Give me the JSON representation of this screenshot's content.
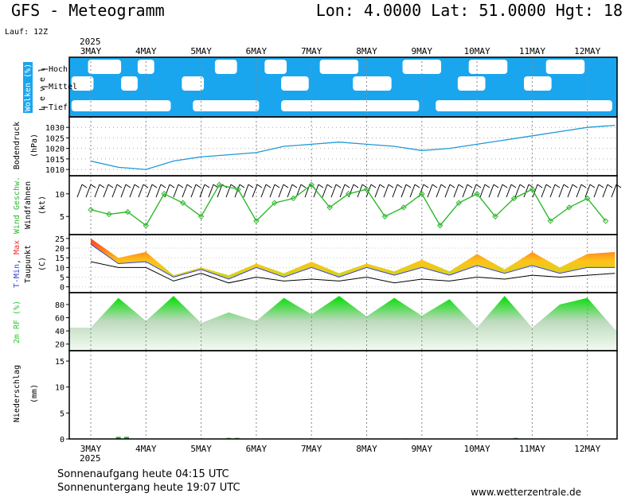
{
  "header": {
    "title": "GFS - Meteogramm",
    "location": "Lon: 4.0000  Lat: 51.0000  Hgt: 18",
    "run": "Lauf: 12Z",
    "year": "2025"
  },
  "footer": {
    "sunrise": "Sonnenaufgang heute 04:15 UTC",
    "sunset": "Sonnenuntergang heute 19:07 UTC",
    "site": "www.wetterzentrale.de"
  },
  "colors": {
    "cloud_sky": "#1aa6ee",
    "pressure": "#1f9ad6",
    "wind": "#2db82d",
    "tmin": "#3344dd",
    "tmax": "#ee3333",
    "dew": "#000000",
    "rh": "#2ec82e",
    "precip": "#2aa82a"
  },
  "chart_data": [
    {
      "type": "heatmap",
      "panel": "clouds",
      "ylabel": "Wolken (%)",
      "ylabel2": "L e v e l",
      "levels": [
        "Hoch",
        "Mittel",
        "Tief"
      ],
      "categories": [
        "3MAY",
        "4MAY",
        "5MAY",
        "6MAY",
        "7MAY",
        "8MAY",
        "9MAY",
        "10MAY",
        "11MAY",
        "12MAY"
      ]
    },
    {
      "type": "line",
      "panel": "pressure",
      "ylabel": "Bodendruck",
      "unit": "(hPa)",
      "ylim": [
        1007,
        1035
      ],
      "yticks": [
        1010,
        1015,
        1020,
        1025,
        1030
      ],
      "x_days": [
        0.0,
        0.5,
        1.0,
        1.5,
        2.0,
        2.5,
        3.0,
        3.5,
        4.0,
        4.5,
        5.0,
        5.5,
        6.0,
        6.5,
        7.0,
        7.5,
        8.0,
        8.5,
        9.0,
        9.5
      ],
      "series": [
        {
          "values": [
            1014,
            1011,
            1010,
            1014,
            1016,
            1017,
            1018,
            1021,
            1022,
            1023,
            1022,
            1021,
            1019,
            1020,
            1022,
            1024,
            1026,
            1028,
            1030,
            1031
          ]
        }
      ]
    },
    {
      "type": "line",
      "panel": "wind",
      "ylabel": "Wind Geschw.",
      "ylabel2": "Windfahnen",
      "unit": "(kt)",
      "ylim": [
        1,
        14
      ],
      "yticks": [
        5,
        10
      ],
      "x_days": [
        0.0,
        0.33,
        0.67,
        1.0,
        1.33,
        1.67,
        2.0,
        2.33,
        2.67,
        3.0,
        3.33,
        3.67,
        4.0,
        4.33,
        4.67,
        5.0,
        5.33,
        5.67,
        6.0,
        6.33,
        6.67,
        7.0,
        7.33,
        7.67,
        8.0,
        8.33,
        8.67,
        9.0,
        9.33
      ],
      "series": [
        {
          "values": [
            6.5,
            5.5,
            6,
            3,
            10,
            8,
            5,
            12,
            11,
            4,
            8,
            9,
            12,
            7,
            10,
            11,
            5,
            7,
            10,
            3,
            8,
            10,
            5,
            9,
            11,
            4,
            7,
            9,
            4
          ]
        }
      ]
    },
    {
      "type": "area",
      "panel": "temperature",
      "ylabel": "T-Min, Max",
      "ylabel2": "Taupunkt",
      "unit": "(C)",
      "ylim": [
        -3,
        27
      ],
      "yticks": [
        0,
        5,
        10,
        15,
        20,
        25
      ],
      "x_days": [
        0.0,
        0.5,
        1.0,
        1.5,
        2.0,
        2.5,
        3.0,
        3.5,
        4.0,
        4.5,
        5.0,
        5.5,
        6.0,
        6.5,
        7.0,
        7.5,
        8.0,
        8.5,
        9.0,
        9.5
      ],
      "series": [
        {
          "name": "T-Max",
          "values": [
            25,
            15,
            18,
            6,
            10,
            6,
            12,
            7,
            13,
            7,
            12,
            8,
            14,
            8,
            17,
            9,
            18,
            10,
            17,
            18
          ]
        },
        {
          "name": "T-Min",
          "values": [
            22,
            12,
            13,
            5,
            9,
            4,
            10,
            5,
            10,
            5,
            10,
            6,
            10,
            6,
            11,
            7,
            11,
            7,
            10,
            10
          ]
        },
        {
          "name": "Taupunkt",
          "values": [
            13,
            10,
            10,
            3,
            7,
            2,
            5,
            3,
            4,
            3,
            5,
            2,
            4,
            3,
            5,
            4,
            6,
            5,
            6,
            7
          ]
        }
      ]
    },
    {
      "type": "area",
      "panel": "humidity",
      "ylabel": "2m RF (%)",
      "ylim": [
        10,
        98
      ],
      "yticks": [
        20,
        40,
        60,
        80
      ],
      "x_days": [
        0.0,
        0.5,
        1.0,
        1.5,
        2.0,
        2.5,
        3.0,
        3.5,
        4.0,
        4.5,
        5.0,
        5.5,
        6.0,
        6.5,
        7.0,
        7.5,
        8.0,
        8.5,
        9.0,
        9.5
      ],
      "series": [
        {
          "values": [
            45,
            90,
            55,
            93,
            52,
            68,
            55,
            90,
            65,
            93,
            62,
            90,
            63,
            88,
            45,
            93,
            45,
            80,
            90,
            42
          ]
        }
      ]
    },
    {
      "type": "bar",
      "panel": "precipitation",
      "ylabel": "Niederschlag",
      "unit": "(mm)",
      "ylim": [
        0,
        17
      ],
      "yticks": [
        0,
        5,
        10,
        15
      ],
      "x_days": [
        0.5,
        0.65,
        2.0,
        2.5,
        2.65,
        4.0,
        5.7,
        7.7,
        8.2
      ],
      "values": [
        0.4,
        0.4,
        0.1,
        0.2,
        0.2,
        0.1,
        0.1,
        0.2,
        0.1
      ]
    }
  ]
}
